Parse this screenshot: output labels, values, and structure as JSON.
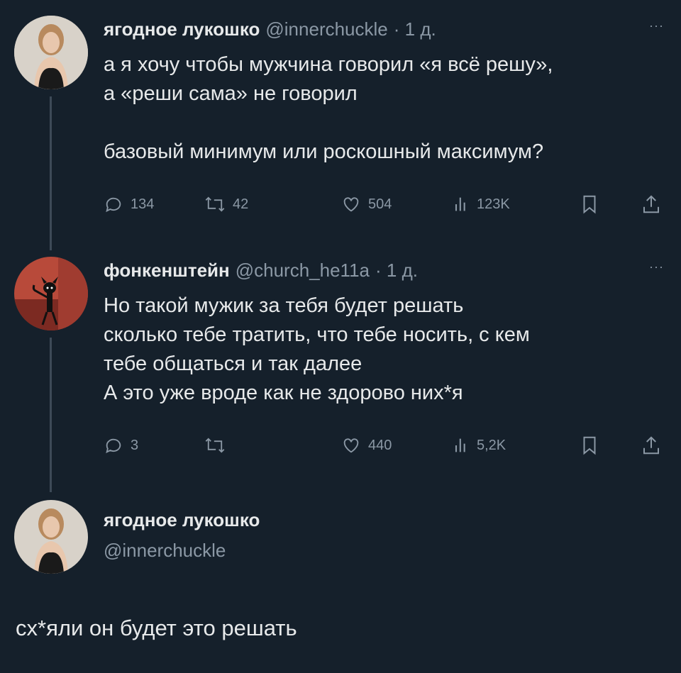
{
  "tweets": [
    {
      "name": "ягодное лукошко",
      "handle": "@innerchuckle",
      "time": "· 1 д.",
      "text_lines": [
        "а я хочу чтобы мужчина говорил «я всё решу»,",
        "а «реши сама» не говорил"
      ],
      "text_lines2": [
        "базовый минимум или роскошный максимум?"
      ],
      "replies": "134",
      "retweets": "42",
      "likes": "504",
      "views": "123K"
    },
    {
      "name": "фонкенштейн",
      "handle": "@church_he11a",
      "time": "· 1 д.",
      "text_lines": [
        "Но такой мужик за тебя будет решать",
        "сколько тебе тратить, что тебе носить, с кем",
        "тебе общаться и так далее",
        "А это уже вроде как не здорово них*я"
      ],
      "replies": "3",
      "retweets": "",
      "likes": "440",
      "views": "5,2K"
    }
  ],
  "reply_author": {
    "name": "ягодное лукошко",
    "handle": "@innerchuckle"
  },
  "reply_text": "сх*яли он будет это решать",
  "more_label": "···",
  "colors": {
    "background": "#15202b",
    "text": "#e7e9ea",
    "muted": "#8b98a5",
    "thread_line": "#3d4a57"
  },
  "icons": [
    "reply-icon",
    "retweet-icon",
    "like-icon",
    "views-icon",
    "bookmark-icon",
    "share-icon",
    "more-icon"
  ]
}
